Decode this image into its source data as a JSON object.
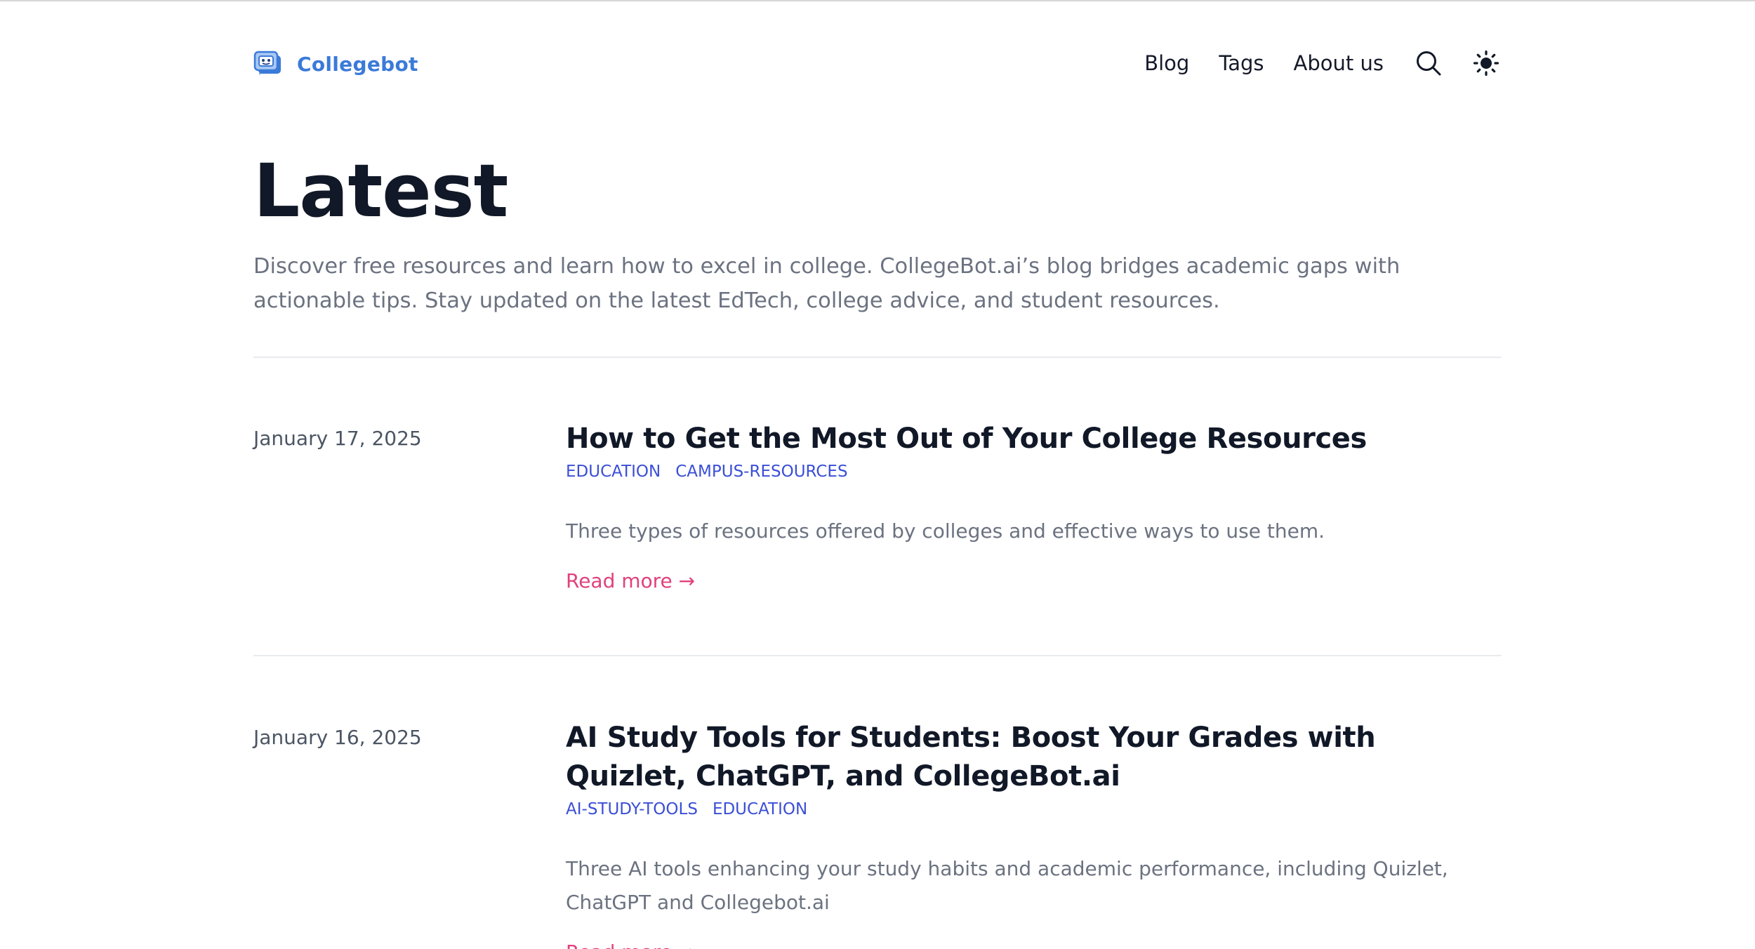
{
  "brand": {
    "name": "Collegebot",
    "logo_icon": "robot-chat-icon"
  },
  "nav": {
    "items": [
      {
        "label": "Blog"
      },
      {
        "label": "Tags"
      },
      {
        "label": "About us"
      }
    ],
    "search_icon": "search-icon",
    "theme_icon": "sun-icon"
  },
  "hero": {
    "title": "Latest",
    "description": "Discover free resources and learn how to excel in college. CollegeBot.ai’s blog bridges academic gaps with actionable tips. Stay updated on the latest EdTech, college advice, and student resources."
  },
  "posts": [
    {
      "date": "January 17, 2025",
      "title": "How to Get the Most Out of Your College Resources",
      "tags": [
        "EDUCATION",
        "CAMPUS-RESOURCES"
      ],
      "summary": "Three types of resources offered by colleges and effective ways to use them.",
      "read_more": "Read more →"
    },
    {
      "date": "January 16, 2025",
      "title": "AI Study Tools for Students: Boost Your Grades with Quizlet, ChatGPT, and CollegeBot.ai",
      "tags": [
        "AI-STUDY-TOOLS",
        "EDUCATION"
      ],
      "summary": "Three AI tools enhancing your study habits and academic performance, including Quizlet, ChatGPT and Collegebot.ai",
      "read_more": "Read more →"
    }
  ],
  "colors": {
    "brand": "#3b7ad9",
    "tag": "#3b4fd6",
    "read_more": "#e0417d",
    "heading": "#111827",
    "muted": "#6b7280"
  }
}
